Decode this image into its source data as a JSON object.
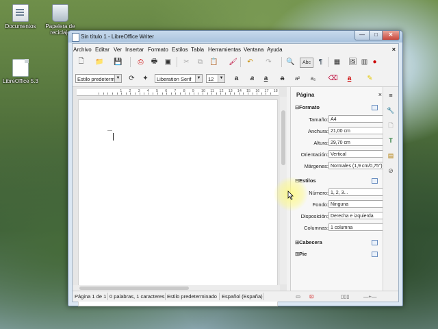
{
  "desktop": {
    "icons": [
      {
        "label": "Documentos",
        "icon": "documents-icon"
      },
      {
        "label": "Papelera de reciclaje",
        "icon": "recycle-bin-icon"
      },
      {
        "label": "LibreOffice 5.3",
        "icon": "libreoffice-file-icon"
      }
    ]
  },
  "window": {
    "title": "Sin título 1 - LibreOffice Writer",
    "controls": {
      "minimize": "—",
      "maximize": "□",
      "close": "✕"
    }
  },
  "menu": {
    "items": [
      "Archivo",
      "Editar",
      "Ver",
      "Insertar",
      "Formato",
      "Estilos",
      "Tabla",
      "Herramientas",
      "Ventana",
      "Ayuda"
    ],
    "close_doc": "×"
  },
  "formatting": {
    "paragraph_style": "Estilo predetermi",
    "font_name": "Liberation Serif",
    "font_size": "12"
  },
  "sidebar": {
    "title": "Página",
    "close": "×",
    "formato": {
      "title": "Formato",
      "tamano_label": "Tamaño:",
      "tamano": "A4",
      "anchura_label": "Anchura:",
      "anchura": "21,00 cm",
      "altura_label": "Altura:",
      "altura": "29,70 cm",
      "orientacion_label": "Orientación:",
      "orientacion": "Vertical",
      "margenes_label": "Márgenes:",
      "margenes": "Normales (1,9 cm/0,75\")"
    },
    "estilos": {
      "title": "Estilos",
      "numero_label": "Número:",
      "numero": "1, 2, 3...",
      "fondo_label": "Fondo:",
      "fondo": "Ninguna",
      "disposicion_label": "Disposición:",
      "disposicion": "Derecha e izquierda",
      "columnas_label": "Columnas:",
      "columnas": "1 columna"
    },
    "cabecera": {
      "title": "Cabecera"
    },
    "pie": {
      "title": "Pie"
    },
    "collapse_minus": "⊟",
    "expand_plus": "⊞"
  },
  "ruler": {
    "numbers": [
      "1",
      "2",
      "3",
      "4",
      "5",
      "6",
      "7",
      "8",
      "9",
      "10",
      "11",
      "12",
      "13",
      "14",
      "15",
      "16",
      "17",
      "18"
    ]
  },
  "status": {
    "page": "Página 1 de 1",
    "words": "0 palabras, 1 caracteres",
    "style": "Estilo predeterminado",
    "language": "Español (España)"
  },
  "colors": {
    "accent": "#6a8ebf",
    "title_gradient_top": "#c7d9ec",
    "close_red": "#c9453a"
  }
}
